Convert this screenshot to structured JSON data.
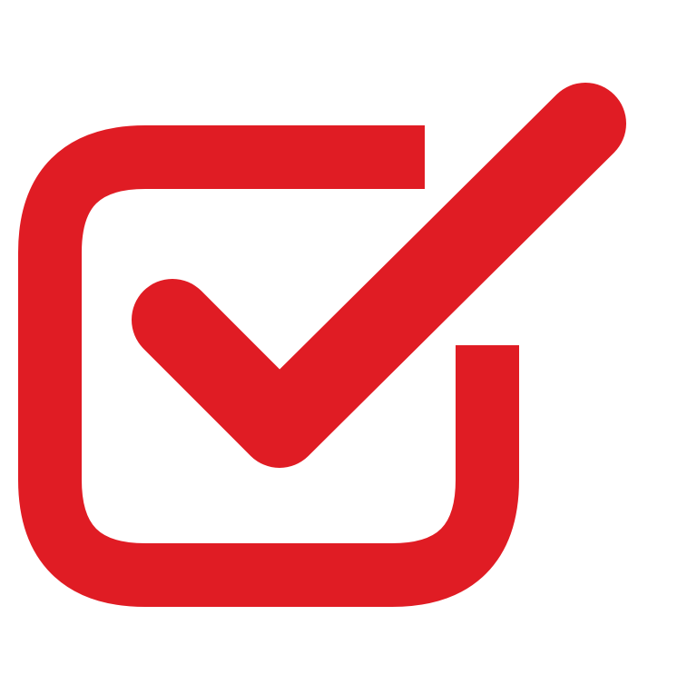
{
  "icon": {
    "name": "checkbox-checked-icon",
    "checked": true,
    "color": "#e01c24",
    "background": "#ffffff"
  }
}
